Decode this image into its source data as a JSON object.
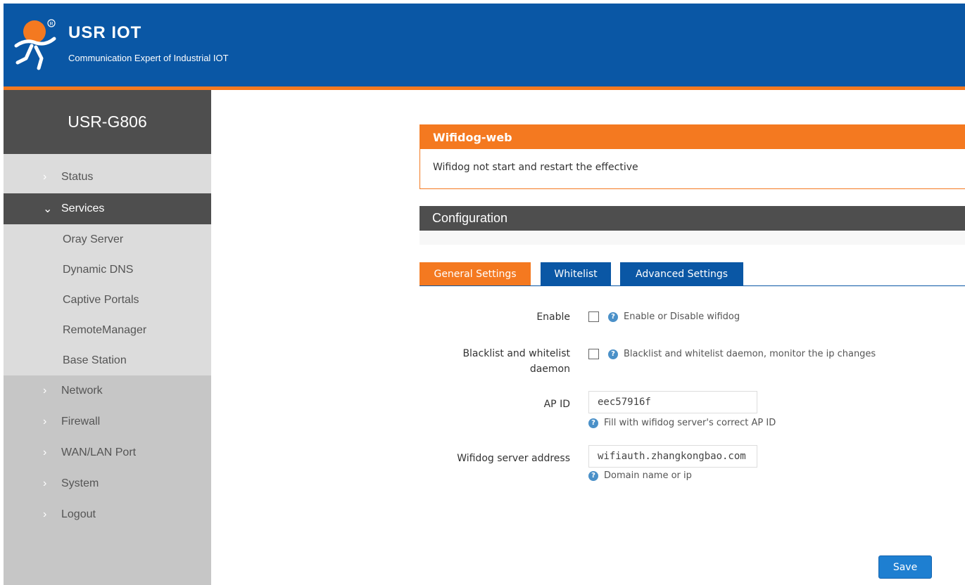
{
  "header": {
    "brand": "USR IOT",
    "tagline": "Communication Expert of Industrial IOT",
    "logo_icon": "usr-runner-logo",
    "colors": {
      "blue": "#0a57a5",
      "orange": "#f47920"
    }
  },
  "sidebar": {
    "device": "USR-G806",
    "items": [
      {
        "label": "Status",
        "state": "collapsed"
      },
      {
        "label": "Services",
        "state": "expanded"
      },
      {
        "label": "Network",
        "state": "collapsed"
      },
      {
        "label": "Firewall",
        "state": "collapsed"
      },
      {
        "label": "WAN/LAN Port",
        "state": "collapsed"
      },
      {
        "label": "System",
        "state": "collapsed"
      },
      {
        "label": "Logout",
        "state": "collapsed"
      }
    ],
    "services_sub": [
      {
        "label": "Oray Server"
      },
      {
        "label": "Dynamic DNS"
      },
      {
        "label": "Captive Portals"
      },
      {
        "label": "RemoteManager"
      },
      {
        "label": "Base Station"
      }
    ]
  },
  "panel": {
    "title": "Wifidog-web",
    "message": "Wifidog not start and restart the effective"
  },
  "config": {
    "title": "Configuration",
    "tabs": [
      {
        "label": "General Settings",
        "active": true
      },
      {
        "label": "Whitelist",
        "active": false
      },
      {
        "label": "Advanced Settings",
        "active": false
      }
    ]
  },
  "form": {
    "enable": {
      "label": "Enable",
      "checked": false,
      "help": "Enable or Disable wifidog"
    },
    "daemon": {
      "label_line1": "Blacklist and whitelist",
      "label_line2": "daemon",
      "checked": false,
      "help": "Blacklist and whitelist daemon, monitor the ip changes"
    },
    "ap_id": {
      "label": "AP ID",
      "value": "eec57916f",
      "help": "Fill with wifidog server's correct AP ID"
    },
    "server": {
      "label": "Wifidog server address",
      "value": "wifiauth.zhangkongbao.com",
      "help": "Domain name or ip"
    }
  },
  "actions": {
    "save": "Save"
  }
}
